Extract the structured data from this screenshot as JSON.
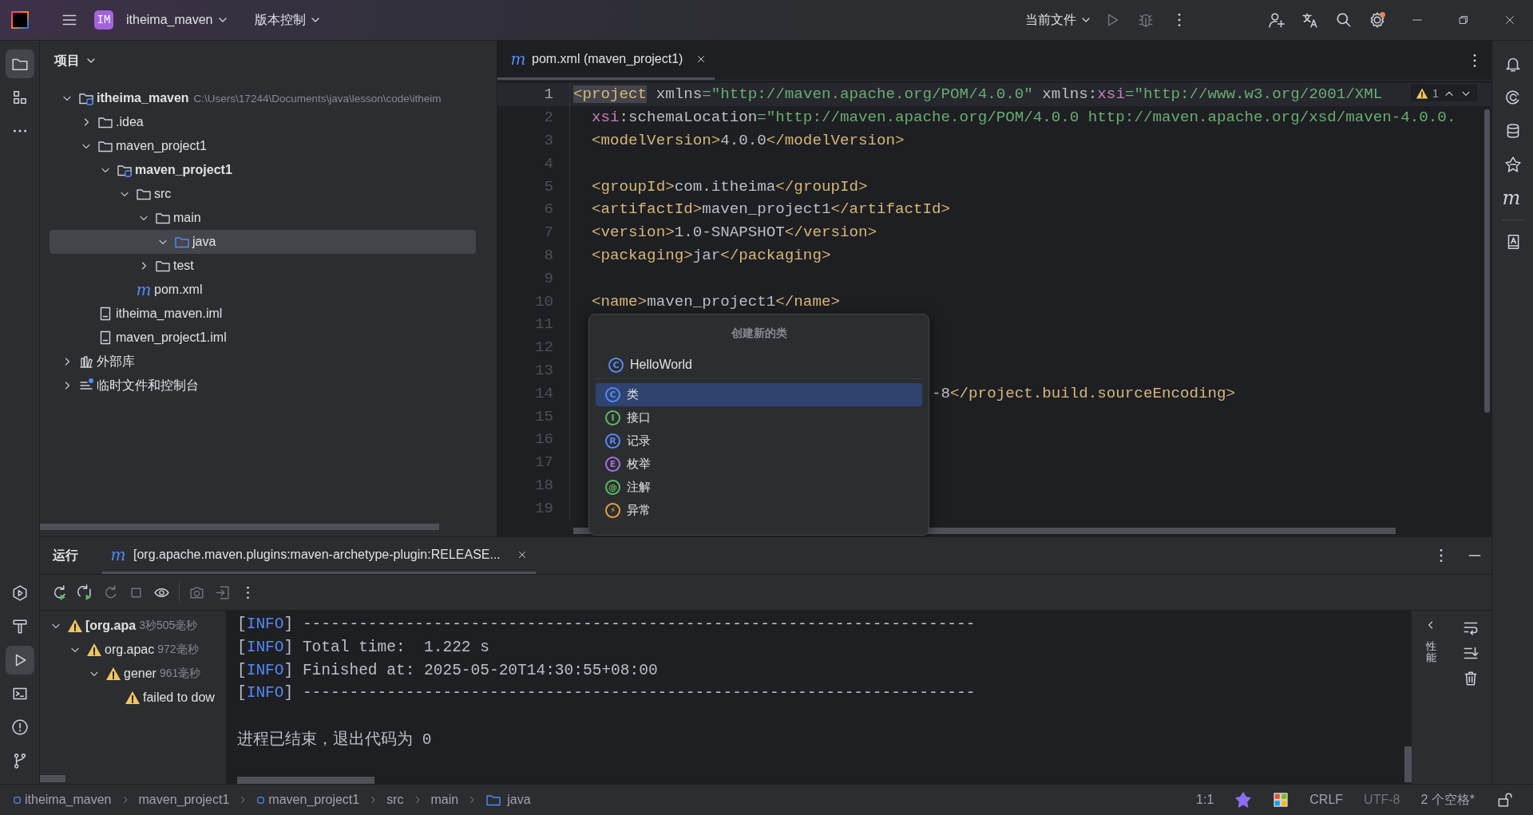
{
  "title_bar": {
    "project_badge": "IM",
    "project_name": "itheima_maven",
    "vcs_menu": "版本控制",
    "run_config": "当前文件"
  },
  "left_toolbar": {
    "top": [
      {
        "kind": "project",
        "selected": true
      },
      {
        "kind": "structure",
        "selected": false
      },
      {
        "kind": "more",
        "selected": false
      }
    ],
    "bottom": [
      {
        "kind": "services",
        "selected": false
      },
      {
        "kind": "build",
        "selected": false
      },
      {
        "kind": "run",
        "selected": true
      },
      {
        "kind": "terminal",
        "selected": false
      },
      {
        "kind": "problems",
        "selected": false
      },
      {
        "kind": "git",
        "selected": false
      }
    ]
  },
  "project_panel": {
    "title": "项目",
    "tree": [
      {
        "kind": "module",
        "label": "itheima_maven",
        "path": "C:\\Users\\17244\\Documents\\java\\lesson\\code\\itheim",
        "expanded": true,
        "selected": false,
        "children": [
          {
            "kind": "folder",
            "label": ".idea",
            "expanded": false,
            "selected": false
          },
          {
            "kind": "folder",
            "label": "maven_project1",
            "expanded": true,
            "selected": false,
            "children": [
              {
                "kind": "module",
                "label": "maven_project1",
                "expanded": true,
                "selected": false,
                "children": [
                  {
                    "kind": "folder",
                    "label": "src",
                    "expanded": true,
                    "selected": false,
                    "children": [
                      {
                        "kind": "folder",
                        "label": "main",
                        "expanded": true,
                        "selected": false,
                        "children": [
                          {
                            "kind": "source-folder",
                            "label": "java",
                            "expanded": true,
                            "selected": true
                          }
                        ]
                      },
                      {
                        "kind": "folder",
                        "label": "test",
                        "expanded": false,
                        "selected": false
                      }
                    ]
                  },
                  {
                    "kind": "maven",
                    "glyph": "m",
                    "label": "pom.xml",
                    "selected": false
                  }
                ]
              }
            ]
          },
          {
            "kind": "file",
            "label": "itheima_maven.iml",
            "selected": false
          },
          {
            "kind": "file",
            "label": "maven_project1.iml",
            "selected": false
          }
        ]
      },
      {
        "kind": "library",
        "label": "外部库",
        "expanded": false,
        "selected": false
      },
      {
        "kind": "scratch",
        "label": "临时文件和控制台",
        "expanded": false,
        "selected": false
      }
    ]
  },
  "editor": {
    "tabs": [
      {
        "glyph": "m",
        "label": "pom.xml (maven_project1)",
        "selected": true
      }
    ],
    "warning_count": "1",
    "lines": [
      {
        "number": "1",
        "kind": "code",
        "current": true,
        "tokens": [
          {
            "kind": "tag-match",
            "text": "<project"
          },
          {
            "kind": "attr",
            "text": " xmlns"
          },
          {
            "kind": "punct",
            "text": "="
          },
          {
            "kind": "value",
            "text": "\"http://maven.apache.org/POM/4.0.0\""
          },
          {
            "kind": "attr",
            "text": " xmlns:"
          },
          {
            "kind": "ns",
            "text": "xsi"
          },
          {
            "kind": "punct",
            "text": "="
          },
          {
            "kind": "value",
            "text": "\"http://www.w3.org/2001/XML"
          }
        ]
      },
      {
        "number": "2",
        "kind": "code",
        "current": false,
        "tokens": [
          {
            "kind": "ns",
            "text": "  xsi"
          },
          {
            "kind": "attr",
            "text": ":schemaLocation"
          },
          {
            "kind": "punct",
            "text": "="
          },
          {
            "kind": "value",
            "text": "\"http://maven.apache.org/POM/4.0.0 http://maven.apache.org/xsd/maven-4.0.0."
          }
        ]
      },
      {
        "number": "3",
        "kind": "code",
        "current": false,
        "tokens": [
          {
            "kind": "tag",
            "text": "  <modelVersion>"
          },
          {
            "kind": "text",
            "text": "4.0.0"
          },
          {
            "kind": "tag",
            "text": "</modelVersion>"
          }
        ]
      },
      {
        "number": "4",
        "kind": "code",
        "current": false
      },
      {
        "number": "5",
        "kind": "code",
        "current": false,
        "tokens": [
          {
            "kind": "tag",
            "text": "  <groupId>"
          },
          {
            "kind": "text",
            "text": "com.itheima"
          },
          {
            "kind": "tag",
            "text": "</groupId>"
          }
        ]
      },
      {
        "number": "6",
        "kind": "code",
        "current": false,
        "tokens": [
          {
            "kind": "tag",
            "text": "  <artifactId>"
          },
          {
            "kind": "text",
            "text": "maven_project1"
          },
          {
            "kind": "tag",
            "text": "</artifactId>"
          }
        ]
      },
      {
        "number": "7",
        "kind": "code",
        "current": false,
        "tokens": [
          {
            "kind": "tag",
            "text": "  <version>"
          },
          {
            "kind": "text",
            "text": "1.0-SNAPSHOT"
          },
          {
            "kind": "tag",
            "text": "</version>"
          }
        ]
      },
      {
        "number": "8",
        "kind": "code",
        "current": false,
        "tokens": [
          {
            "kind": "tag",
            "text": "  <packaging>"
          },
          {
            "kind": "text",
            "text": "jar"
          },
          {
            "kind": "tag",
            "text": "</packaging>"
          }
        ]
      },
      {
        "number": "9",
        "kind": "code",
        "current": false
      },
      {
        "number": "10",
        "kind": "code",
        "current": false,
        "tokens": [
          {
            "kind": "tag",
            "text": "  <name>"
          },
          {
            "kind": "text",
            "text": "maven_project1"
          },
          {
            "kind": "tag",
            "text": "</name>"
          }
        ]
      },
      {
        "number": "11",
        "kind": "code",
        "current": false
      },
      {
        "number": "12",
        "kind": "code",
        "current": false
      },
      {
        "number": "13",
        "kind": "code",
        "current": false
      },
      {
        "number": "14",
        "kind": "covered",
        "current": false,
        "tokens": [
          {
            "kind": "text",
            "text": "-8"
          },
          {
            "kind": "tag",
            "text": "</project.build.sourceEncoding>"
          }
        ]
      },
      {
        "number": "15",
        "kind": "code",
        "current": false
      },
      {
        "number": "16",
        "kind": "code",
        "current": false
      },
      {
        "number": "17",
        "kind": "code",
        "current": false
      },
      {
        "number": "18",
        "kind": "code",
        "current": false
      },
      {
        "number": "19",
        "kind": "code",
        "current": false
      }
    ]
  },
  "popup": {
    "title": "创建新的类",
    "name_glyph": "C",
    "name_value": "HelloWorld",
    "items": [
      {
        "glyph": "C",
        "label": "类",
        "color": "#548af7",
        "selected": true
      },
      {
        "glyph": "I",
        "label": "接口",
        "color": "#5fb865",
        "selected": false
      },
      {
        "glyph": "R",
        "label": "记录",
        "color": "#548af7",
        "selected": false
      },
      {
        "glyph": "E",
        "label": "枚举",
        "color": "#a571e6",
        "selected": false
      },
      {
        "glyph": "@",
        "label": "注解",
        "color": "#5fb865",
        "selected": false
      },
      {
        "glyph": "⚡",
        "label": "异常",
        "color": "#e5a042",
        "selected": false
      }
    ]
  },
  "right_toolbar": [
    {
      "kind": "bell"
    },
    {
      "kind": "spiral"
    },
    {
      "kind": "database"
    },
    {
      "kind": "star"
    },
    {
      "kind": "maven",
      "glyph": "m"
    },
    {
      "kind": "book"
    }
  ],
  "run_panel": {
    "title": "运行",
    "tabs": [
      {
        "glyph": "m",
        "label": "[org.apache.maven.plugins:maven-archetype-plugin:RELEASE...",
        "selected": true
      }
    ],
    "toolbar": [
      {
        "kind": "rerun",
        "disabled": false
      },
      {
        "kind": "rerun-failed",
        "disabled": false
      },
      {
        "kind": "rerun-debug",
        "disabled": true
      },
      {
        "kind": "stop",
        "disabled": true
      },
      {
        "kind": "eye",
        "disabled": false
      },
      {
        "kind": "camera",
        "disabled": true
      },
      {
        "kind": "exit",
        "disabled": true
      },
      {
        "kind": "more",
        "disabled": false
      }
    ],
    "tree": [
      {
        "label": "[org.apa",
        "time": "3秒505毫秒",
        "bold": true,
        "expanded": true,
        "selected": false,
        "children": [
          {
            "label": "org.apac",
            "time": "972毫秒",
            "bold": false,
            "expanded": true,
            "selected": false,
            "children": [
              {
                "label": "gener",
                "time": "961毫秒",
                "bold": false,
                "expanded": true,
                "selected": false,
                "children": [
                  {
                    "label": "failed to dow",
                    "bold": false,
                    "selected": false
                  }
                ]
              }
            ]
          }
        ]
      }
    ],
    "console": [
      {
        "kind": "output",
        "tokens": [
          {
            "kind": "plain",
            "text": "["
          },
          {
            "kind": "info",
            "text": "INFO"
          },
          {
            "kind": "plain",
            "text": "] ------------------------------------------------------------------------"
          }
        ]
      },
      {
        "kind": "output",
        "tokens": [
          {
            "kind": "plain",
            "text": "["
          },
          {
            "kind": "info",
            "text": "INFO"
          },
          {
            "kind": "plain",
            "text": "] Total time:  1.222 s"
          }
        ]
      },
      {
        "kind": "output",
        "tokens": [
          {
            "kind": "plain",
            "text": "["
          },
          {
            "kind": "info",
            "text": "INFO"
          },
          {
            "kind": "plain",
            "text": "] Finished at: 2025-05-20T14:30:55+08:00"
          }
        ]
      },
      {
        "kind": "output",
        "tokens": [
          {
            "kind": "plain",
            "text": "["
          },
          {
            "kind": "info",
            "text": "INFO"
          },
          {
            "kind": "plain",
            "text": "] ------------------------------------------------------------------------"
          }
        ]
      },
      {
        "kind": "blank"
      },
      {
        "kind": "output",
        "tokens": [
          {
            "kind": "plain",
            "text": "进程已结束，退出代码为 0"
          }
        ]
      }
    ],
    "side_label": "性能"
  },
  "status_bar": {
    "breadcrumbs": [
      {
        "kind": "module",
        "label": "itheima_maven"
      },
      {
        "kind": "none",
        "label": "maven_project1"
      },
      {
        "kind": "module",
        "label": "maven_project1"
      },
      {
        "kind": "none",
        "label": "src"
      },
      {
        "kind": "none",
        "label": "main"
      },
      {
        "kind": "source-folder",
        "label": "java"
      }
    ],
    "position": "1:1",
    "line_separator": "CRLF",
    "encoding": "UTF-8",
    "indent": "2 个空格*"
  }
}
